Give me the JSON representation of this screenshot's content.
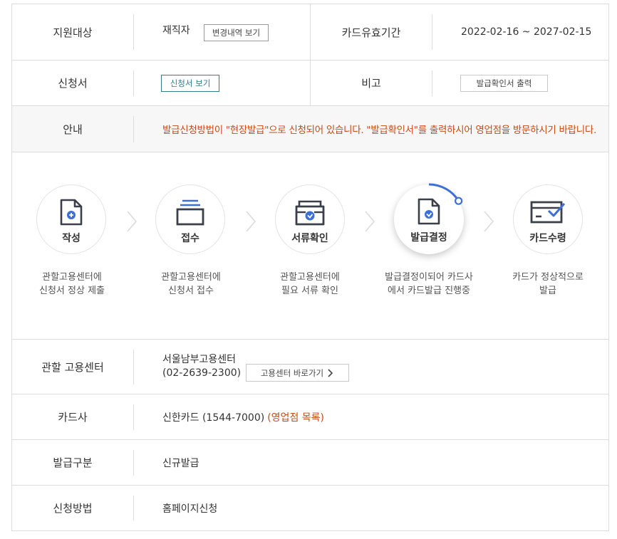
{
  "info": {
    "target_label": "지원대상",
    "target_value": "재직자",
    "history_button": "변경내역 보기",
    "validity_label": "카드유효기간",
    "validity_value": "2022-02-16 ~ 2027-02-15",
    "application_label": "신청서",
    "application_button": "신청서 보기",
    "remark_label": "비고",
    "print_button": "발급확인서 출력",
    "guide_label": "안내",
    "guide_text": "발급신청방법이 \"현장발급\"으로 신청되어 있습니다. \"발급확인서\"를 출력하시어 영업점을 방문하시기 바랍니다."
  },
  "steps": [
    {
      "title": "작성",
      "desc1": "관할고용센터에",
      "desc2": "신청서 정상 제출",
      "icon": "document-plus-icon"
    },
    {
      "title": "접수",
      "desc1": "관할고용센터에",
      "desc2": "신청서 접수",
      "icon": "tray-icon"
    },
    {
      "title": "서류확인",
      "desc1": "관할고용센터에",
      "desc2": "필요 서류 확인",
      "icon": "folder-check-icon"
    },
    {
      "title": "발급결정",
      "desc1": "발급결정이되어 카드사",
      "desc2": "에서 카드발급 진행중",
      "icon": "document-check-icon"
    },
    {
      "title": "카드수령",
      "desc1": "카드가 정상적으로",
      "desc2": "발급",
      "icon": "card-check-icon"
    }
  ],
  "current_step": 4,
  "details": {
    "center_label": "관할 고용센터",
    "center_name": "서울남부고용센터",
    "center_phone": "(02-2639-2300)",
    "center_button": "고용센터 바로가기",
    "card_label": "카드사",
    "card_value": "신한카드 (1544-7000)",
    "card_link": "(영업점 목록)",
    "type_label": "발급구분",
    "type_value": "신규발급",
    "method_label": "신청방법",
    "method_value": "홈페이지신청"
  },
  "colors": {
    "accent_blue": "#3d6fd8",
    "notice_orange": "#c84a14",
    "teal": "#2f7e8a",
    "icon_dark": "#3a3f4a"
  }
}
